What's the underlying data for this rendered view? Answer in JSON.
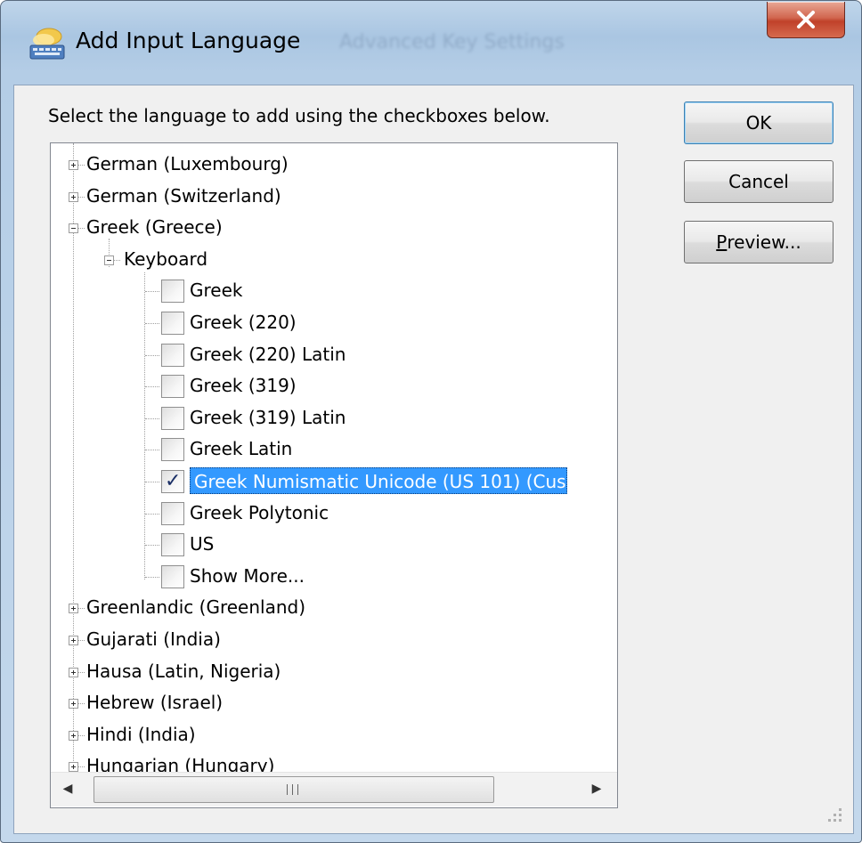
{
  "window": {
    "title": "Add Input Language",
    "background_text": "Advanced Key Settings",
    "close_glyph": "✕"
  },
  "dialog": {
    "instruction": "Select the language to add using the checkboxes below."
  },
  "buttons": {
    "ok": "OK",
    "cancel": "Cancel",
    "preview_mnemonic": "P",
    "preview_rest": "review..."
  },
  "tree": {
    "items": [
      {
        "label": "German (Luxembourg)",
        "expander": "plus"
      },
      {
        "label": "German (Switzerland)",
        "expander": "plus"
      },
      {
        "label": "Greek (Greece)",
        "expander": "minus"
      },
      {
        "label": "Keyboard",
        "expander": "minus"
      },
      {
        "label": "Greek",
        "checked": false
      },
      {
        "label": "Greek (220)",
        "checked": false
      },
      {
        "label": "Greek (220) Latin",
        "checked": false
      },
      {
        "label": "Greek (319)",
        "checked": false
      },
      {
        "label": "Greek (319) Latin",
        "checked": false
      },
      {
        "label": "Greek Latin",
        "checked": false
      },
      {
        "label": "Greek Numismatic Unicode (US 101) (Cus",
        "checked": true,
        "selected": true
      },
      {
        "label": "Greek Polytonic",
        "checked": false
      },
      {
        "label": "US",
        "checked": false
      },
      {
        "label": "Show More...",
        "checked": false
      },
      {
        "label": "Greenlandic (Greenland)",
        "expander": "plus"
      },
      {
        "label": "Gujarati (India)",
        "expander": "plus"
      },
      {
        "label": "Hausa (Latin, Nigeria)",
        "expander": "plus"
      },
      {
        "label": "Hebrew (Israel)",
        "expander": "plus"
      },
      {
        "label": "Hindi (India)",
        "expander": "plus"
      },
      {
        "label": "Hungarian (Hungary)",
        "expander": "plus"
      }
    ]
  },
  "scroll": {
    "up_arrow": "▲",
    "down_arrow": "▼",
    "left_arrow": "◀",
    "right_arrow": "▶"
  },
  "colors": {
    "selection": "#3399ff",
    "check": "#1a2f66",
    "close_button": "#c0412a"
  }
}
